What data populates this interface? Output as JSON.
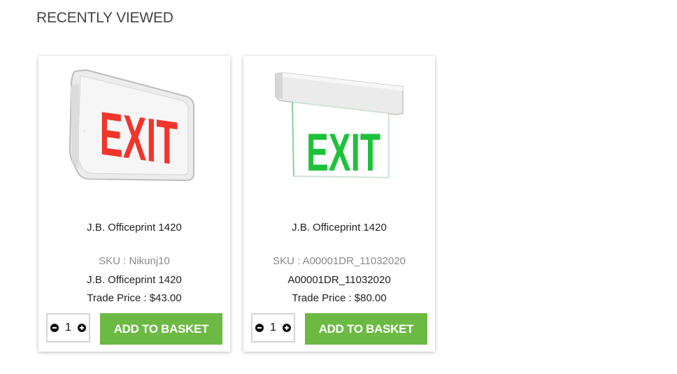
{
  "section": {
    "title": "RECENTLY VIEWED"
  },
  "products": [
    {
      "title": "J.B. Officeprint 1420",
      "sku": "SKU : Nikunj10",
      "subtitle": "J.B. Officeprint 1420",
      "price": "Trade Price : $43.00",
      "quantity": "1",
      "add_label": "ADD TO BASKET",
      "image": {
        "icon": "exit-sign-red",
        "text": "EXIT",
        "color": "#f0352b"
      }
    },
    {
      "title": "J.B. Officeprint 1420",
      "sku": "SKU : A00001DR_11032020",
      "subtitle": "A00001DR_11032020",
      "price": "Trade Price : $80.00",
      "quantity": "1",
      "add_label": "ADD TO BASKET",
      "image": {
        "icon": "exit-sign-green",
        "text": "EXIT",
        "color": "#1ec23a"
      }
    }
  ],
  "colors": {
    "button": "#6cb944",
    "button_text": "#ffffff",
    "heading": "#444444",
    "sku": "#8a8a8a"
  }
}
